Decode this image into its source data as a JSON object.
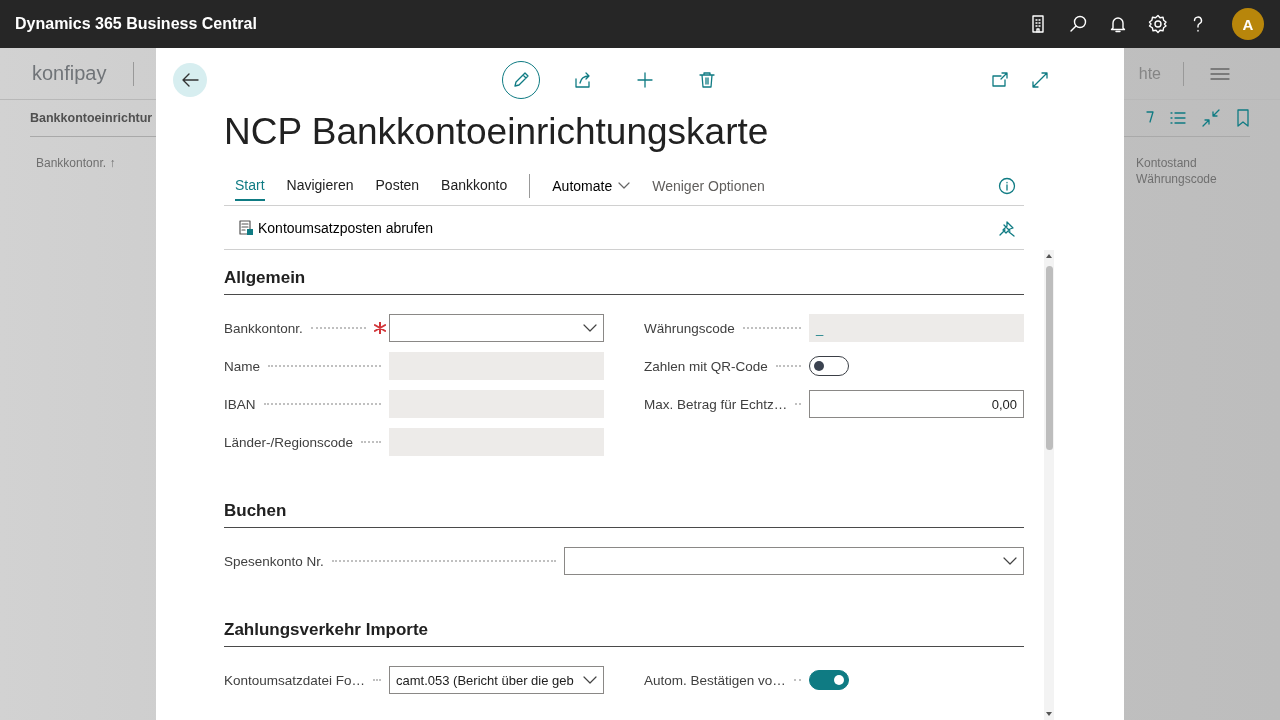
{
  "top_bar": {
    "app_title": "Dynamics 365 Business Central",
    "avatar": "A"
  },
  "background_page": {
    "company": "konfipay",
    "nav_fragment": "hte",
    "page_title": "Bankkontoeinrichtur",
    "columns": [
      "Bankkontonr. ↑",
      "Kontostand Währungscode"
    ]
  },
  "dialog": {
    "title": "NCP Bankkontoeinrichtungskarte",
    "action_tabs": [
      {
        "label": "Start",
        "selected": true
      },
      {
        "label": "Navigieren",
        "selected": false
      },
      {
        "label": "Posten",
        "selected": false
      },
      {
        "label": "Bankkonto",
        "selected": false
      }
    ],
    "menu": {
      "label": "Automate"
    },
    "fewer_options": "Weniger Optionen",
    "actions": [
      {
        "label": "Kontoumsatzposten abrufen"
      }
    ],
    "sections": [
      {
        "title": "Allgemein",
        "columns": [
          [
            {
              "label": "Bankkontonr.",
              "kind": "dropdown",
              "required": true
            },
            {
              "label": "Name",
              "kind": "readonly",
              "required": false
            },
            {
              "label": "IBAN",
              "kind": "readonly",
              "required": false
            },
            {
              "label": "Länder-/Regionscode",
              "kind": "readonly",
              "required": false
            }
          ],
          [
            {
              "label": "Währungscode",
              "kind": "readonly",
              "required": false,
              "value": "_"
            },
            {
              "label": "Zahlen mit QR-Code",
              "kind": "toggle",
              "required": false,
              "on": false
            },
            {
              "label": "Max. Betrag für Echtz…",
              "kind": "number",
              "required": false,
              "value": "0,00"
            }
          ]
        ]
      },
      {
        "title": "Buchen",
        "columns": [
          [
            {
              "label": "Spesenkonto Nr.",
              "kind": "dropdown",
              "required": false
            }
          ]
        ]
      },
      {
        "title": "Zahlungsverkehr Importe",
        "columns": [
          [
            {
              "label": "Kontoumsatzdatei Fo…",
              "kind": "dropdown",
              "required": false,
              "value": "camt.053 (Bericht über die geb"
            }
          ],
          [
            {
              "label": "Autom. Bestätigen vo…",
              "kind": "toggle",
              "required": false,
              "on": true
            }
          ]
        ]
      }
    ]
  }
}
